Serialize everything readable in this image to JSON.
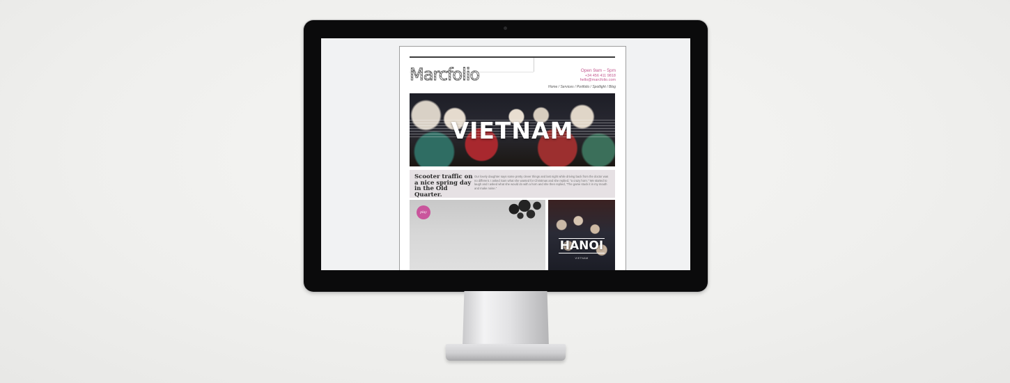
{
  "site": {
    "logo": "Marcfolio",
    "contact": {
      "hours": "Open 9am – 5pm",
      "phone": "+34 456 411 9818",
      "email": "hello@marcfolio.com"
    },
    "nav": [
      "Home",
      "Services",
      "Portfolio",
      "Spotlight",
      "Blog"
    ]
  },
  "hero": {
    "title": "VIETNAM"
  },
  "caption": {
    "title": "Scooter traffic on a nice spring day in the Old Quarter.",
    "body": "Our lovely daughter says some pretty clever things and last night while driving back from the doctor was no different. I asked Sam what she wanted for Christmas and she replied, \"a crazy horn.\" We started to laugh and I asked what she would do with a horn and she then replied, \"The game stuck it in my mouth and make noise.\""
  },
  "video": {
    "play_label": "play"
  },
  "hanoi": {
    "title": "HANOI",
    "subtitle": "VIETNAM"
  }
}
